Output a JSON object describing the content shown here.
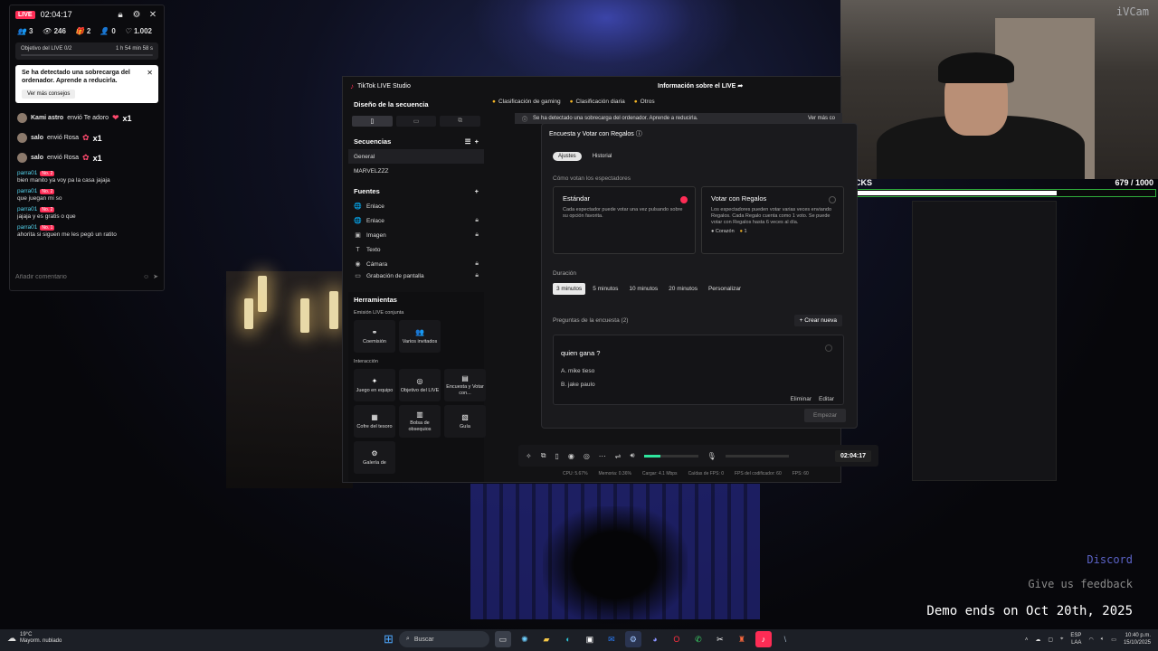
{
  "live_panel": {
    "badge": "LIVE",
    "time": "02:04:17",
    "stats": [
      {
        "icon": "👥",
        "value": "3"
      },
      {
        "icon": "👁",
        "value": "246"
      },
      {
        "icon": "🎁",
        "value": "2"
      },
      {
        "icon": "👤",
        "value": "0"
      },
      {
        "icon": "♡",
        "value": "1.002"
      }
    ],
    "goal": {
      "label": "Objetivo del LIVE",
      "progress": "0/2",
      "remaining": "1 h 54 min 58 s"
    },
    "warning": {
      "title": "Se ha detectado una sobrecarga del ordenador. Aprende a reducirla.",
      "button": "Ver más consejos"
    },
    "gifts": [
      {
        "user": "Kami astro",
        "action": "envió Te adoro",
        "count": "x1"
      },
      {
        "user": "salo",
        "action": "envió Rosa",
        "count": "x1"
      },
      {
        "user": "salo",
        "action": "envió Rosa",
        "count": "x1"
      }
    ],
    "chat": [
      {
        "user": "parra01",
        "rank": "No. 2",
        "text": "bien manito ya voy pa la casa jajaja"
      },
      {
        "user": "parra01",
        "rank": "No. 2",
        "text": "que juegan mi so"
      },
      {
        "user": "parra01",
        "rank": "No. 2",
        "text": "jajaja y es gratis o que"
      },
      {
        "user": "parra01",
        "rank": "No. 1",
        "text": "ahorita si siguen me les pegó un ratito"
      }
    ],
    "comment_placeholder": "Añadir comentario"
  },
  "camera": {
    "logo": "iVCam"
  },
  "kicks": {
    "label": "KICKS",
    "count": "679 / 1000",
    "progress": 0.679
  },
  "studio": {
    "title": "TikTok LIVE Studio",
    "info": "Información sobre el LIVE",
    "scene_design": "Diseño de la secuencia",
    "sequences_header": "Secuencias",
    "sequences": [
      "General",
      "MARVELZZZ"
    ],
    "sources_header": "Fuentes",
    "sources": [
      {
        "icon": "🌐",
        "label": "Enlace",
        "locked": false
      },
      {
        "icon": "🌐",
        "label": "Enlace",
        "locked": true
      },
      {
        "icon": "▣",
        "label": "Imagen",
        "locked": true
      },
      {
        "icon": "T",
        "label": "Texto",
        "locked": false
      },
      {
        "icon": "◉",
        "label": "Cámara",
        "locked": true
      },
      {
        "icon": "▭",
        "label": "Grabación de pantalla",
        "locked": true
      }
    ],
    "tools_header": "Herramientas",
    "joint_header": "Emisión LIVE conjunta",
    "joint_tools": [
      {
        "icon": "⚭",
        "label": "Coemisión"
      },
      {
        "icon": "👥",
        "label": "Varios invitados"
      }
    ],
    "interaction_header": "Interacción",
    "interaction_tools": [
      {
        "icon": "✦",
        "label": "Juego en equipo"
      },
      {
        "icon": "◎",
        "label": "Objetivo del LIVE"
      },
      {
        "icon": "▤",
        "label": "Encuesta y Votar con..."
      },
      {
        "icon": "▦",
        "label": "Cofre del tesoro"
      },
      {
        "icon": "▥",
        "label": "Bolsa de obsequios"
      },
      {
        "icon": "▧",
        "label": "Guía"
      },
      {
        "icon": "⚙",
        "label": "Galería de"
      }
    ],
    "categories": [
      "Clasificación de gaming",
      "Clasificación diaria",
      "Otros"
    ],
    "notice": "Se ha detectado una sobrecarga del ordenador. Aprende a reducirla.",
    "notice_more": "Ver más co"
  },
  "poll": {
    "title": "Encuesta y Votar con Regalos",
    "tabs": [
      "Ajustes",
      "Historial"
    ],
    "vote_question": "Cómo votan los espectadores",
    "option_standard": {
      "title": "Estándar",
      "desc": "Cada espectador puede votar una vez pulsando sobre su opción favorita."
    },
    "option_gifts": {
      "title": "Votar con Regalos",
      "desc": "Los espectadores pueden votar varias veces enviando Regalos. Cada Regalo cuenta como 1 voto. Se puede votar con Regalos hasta 6 veces al día.",
      "gift1": "Corazón",
      "gift2": "1"
    },
    "duration_label": "Duración",
    "durations": [
      "3 minutos",
      "5 minutos",
      "10 minutos",
      "20 minutos",
      "Personalizar"
    ],
    "questions_label": "Preguntas de la encuesta (2)",
    "create_new": "+ Crear nueva",
    "question": {
      "title": "quien gana ?",
      "a": "A. mike tieso",
      "b": "B. jake paulo",
      "delete": "Eliminar",
      "edit": "Editar"
    },
    "start": "Empezar"
  },
  "controls": {
    "time": "02:04:17",
    "perf": [
      "CPU: 5.67%",
      "Memoria: 0.36%",
      "Cargar: 4.1 Mbps",
      "Caídas de FPS: 0",
      "FPS del codificador: 60",
      "FPS: 60"
    ]
  },
  "game": {
    "discord": "Discord",
    "feedback": "Give us feedback",
    "demo": "Demo ends on Oct 20th, 2025"
  },
  "taskbar": {
    "temp": "19°C",
    "weather": "Mayorm. nublado",
    "search": "Buscar",
    "lang": "ESP",
    "lang2": "LAA",
    "time": "10:40 p.m.",
    "date": "15/10/2025"
  }
}
